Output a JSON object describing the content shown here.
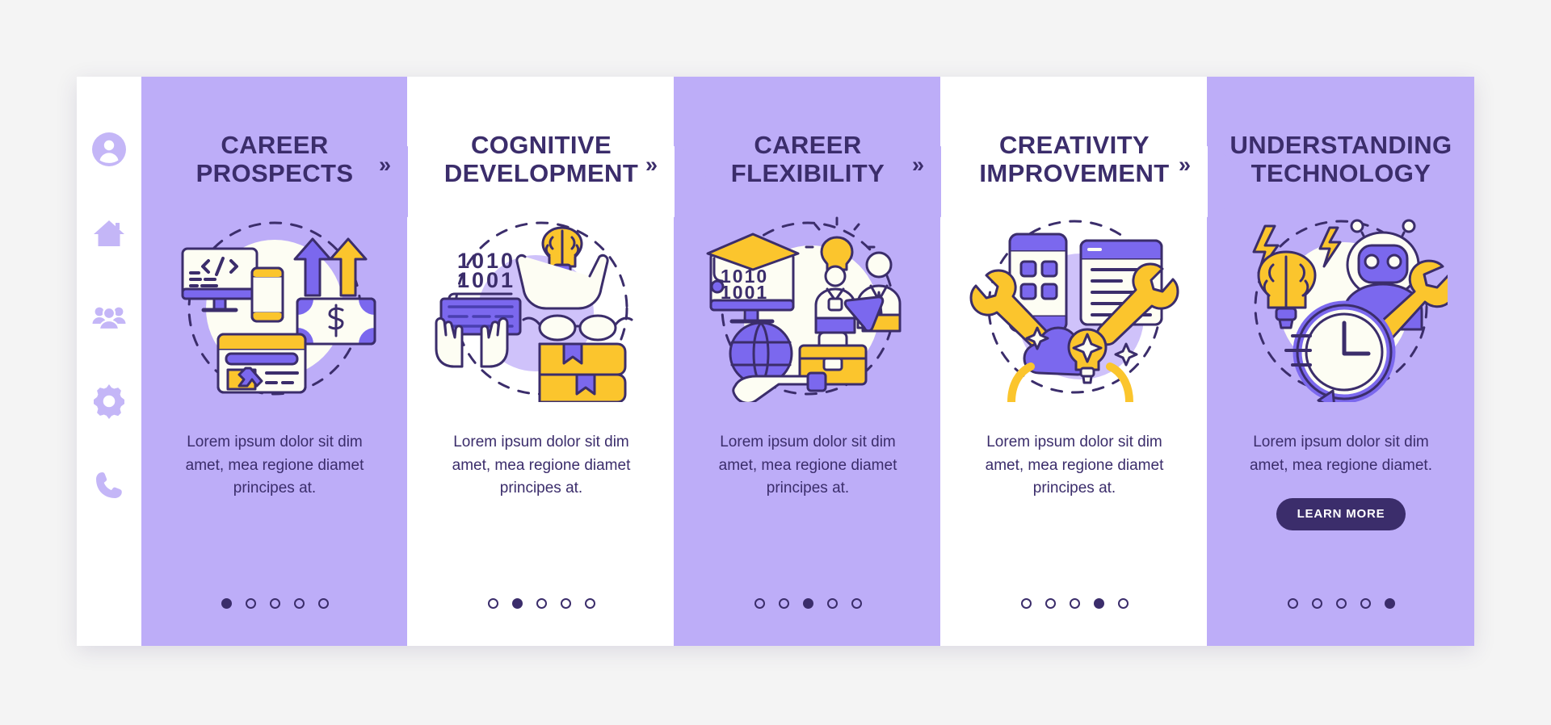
{
  "colors": {
    "page_background": "#f4f4f4",
    "card_purple": "#bdadf8",
    "card_white": "#ffffff",
    "text_dark_purple": "#3b2d6b",
    "accent_yellow": "#fbc52d",
    "accent_violet": "#7b68ee",
    "sidebar_icon": "#c4b6f7",
    "button_background": "#3b2d6b",
    "button_text": "#ffffff"
  },
  "sidebar": {
    "items": [
      {
        "icon": "user-circle-icon",
        "label": "Profile"
      },
      {
        "icon": "home-icon",
        "label": "Home"
      },
      {
        "icon": "people-group-icon",
        "label": "Community"
      },
      {
        "icon": "gear-icon",
        "label": "Settings"
      },
      {
        "icon": "phone-icon",
        "label": "Contact"
      }
    ]
  },
  "separator": {
    "glyph": "»"
  },
  "cards": [
    {
      "title": "CAREER PROSPECTS",
      "body": "Lorem ipsum dolor sit dim amet, mea regione diamet principes at.",
      "theme": "purple",
      "illustration": "career-prospects-illustration",
      "dots": {
        "count": 5,
        "active": 1
      },
      "button": null
    },
    {
      "title": "COGNITIVE DEVELOPMENT",
      "body": "Lorem ipsum dolor sit dim amet, mea regione diamet principes at.",
      "theme": "white",
      "illustration": "cognitive-development-illustration",
      "dots": {
        "count": 5,
        "active": 2
      },
      "button": null
    },
    {
      "title": "CAREER FLEXIBILITY",
      "body": "Lorem ipsum dolor sit dim amet, mea regione diamet principes at.",
      "theme": "purple",
      "illustration": "career-flexibility-illustration",
      "dots": {
        "count": 5,
        "active": 3
      },
      "button": null
    },
    {
      "title": "CREATIVITY IMPROVEMENT",
      "body": "Lorem ipsum dolor sit dim amet, mea regione diamet principes at.",
      "theme": "white",
      "illustration": "creativity-improvement-illustration",
      "dots": {
        "count": 5,
        "active": 4
      },
      "button": null
    },
    {
      "title": "UNDERSTANDING TECHNOLOGY",
      "body": "Lorem ipsum dolor sit dim amet, mea regione diamet.",
      "theme": "purple",
      "illustration": "understanding-technology-illustration",
      "dots": {
        "count": 5,
        "active": 5
      },
      "button": "LEARN MORE"
    }
  ]
}
